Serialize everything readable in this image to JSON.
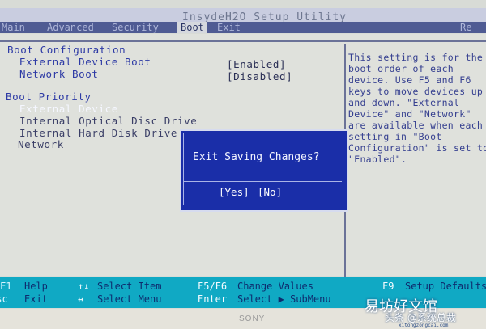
{
  "app": {
    "title": "InsydeH2O Setup Utility"
  },
  "menu": {
    "items": [
      {
        "label": "Main"
      },
      {
        "label": "Advanced"
      },
      {
        "label": "Security"
      },
      {
        "label": "Boot"
      },
      {
        "label": "Exit"
      }
    ],
    "active": "Boot",
    "right_label": "Re"
  },
  "boot_config": {
    "heading": "Boot Configuration",
    "items": [
      {
        "label": "External Device Boot",
        "value": "[Enabled]"
      },
      {
        "label": "Network Boot",
        "value": "[Disabled]"
      }
    ]
  },
  "boot_priority": {
    "heading": "Boot Priority",
    "items": [
      {
        "label": "External Device"
      },
      {
        "label": "Internal Optical Disc Drive"
      },
      {
        "label": "Internal Hard Disk Drive"
      },
      {
        "label": "Network"
      }
    ]
  },
  "help_panel": {
    "lines": [
      "This setting is for the",
      "boot order of each",
      "device. Use F5 and F6",
      "keys to move devices up",
      "and down. \"External",
      "Device\" and \"Network\"",
      "are available when each",
      "setting in \"Boot",
      "Configuration\" is set to",
      "\"Enabled\"."
    ]
  },
  "dialog": {
    "title": "Exit Saving Changes?",
    "yes": "[Yes]",
    "no": "[No]"
  },
  "footer": {
    "row1": [
      {
        "key": "F1",
        "label": "Help"
      },
      {
        "key": "↑↓",
        "label": "Select Item"
      },
      {
        "key": "F5/F6",
        "label": "Change Values"
      },
      {
        "key": "F9",
        "label": "Setup Defaults"
      }
    ],
    "row2": [
      {
        "key": "Esc",
        "label": "Exit"
      },
      {
        "key": "↔",
        "label": "Select Menu"
      },
      {
        "key": "Enter",
        "label": "Select ▶ SubMenu"
      }
    ]
  },
  "bezel": {
    "brand": "SONY"
  },
  "watermark": {
    "title": "易坊好文馆",
    "sub": "头条 @系统总裁",
    "url": "xitongzongcai.com"
  }
}
